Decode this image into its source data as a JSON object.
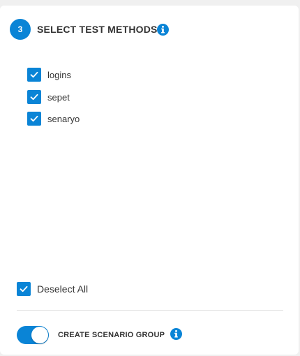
{
  "step": {
    "number": "3"
  },
  "section": {
    "title": "SELECT TEST METHODS*"
  },
  "methods": [
    {
      "label": "logins",
      "checked": true
    },
    {
      "label": "sepet",
      "checked": true
    },
    {
      "label": "senaryo",
      "checked": true
    }
  ],
  "deselect_all": {
    "label": "Deselect All",
    "checked": true
  },
  "scenario_group": {
    "label": "CREATE SCENARIO GROUP",
    "enabled": true
  },
  "colors": {
    "accent": "#0a84d6",
    "background": "#f0f0f0",
    "panel": "#ffffff"
  },
  "icons": {
    "info": "info-icon",
    "check": "check-icon"
  }
}
